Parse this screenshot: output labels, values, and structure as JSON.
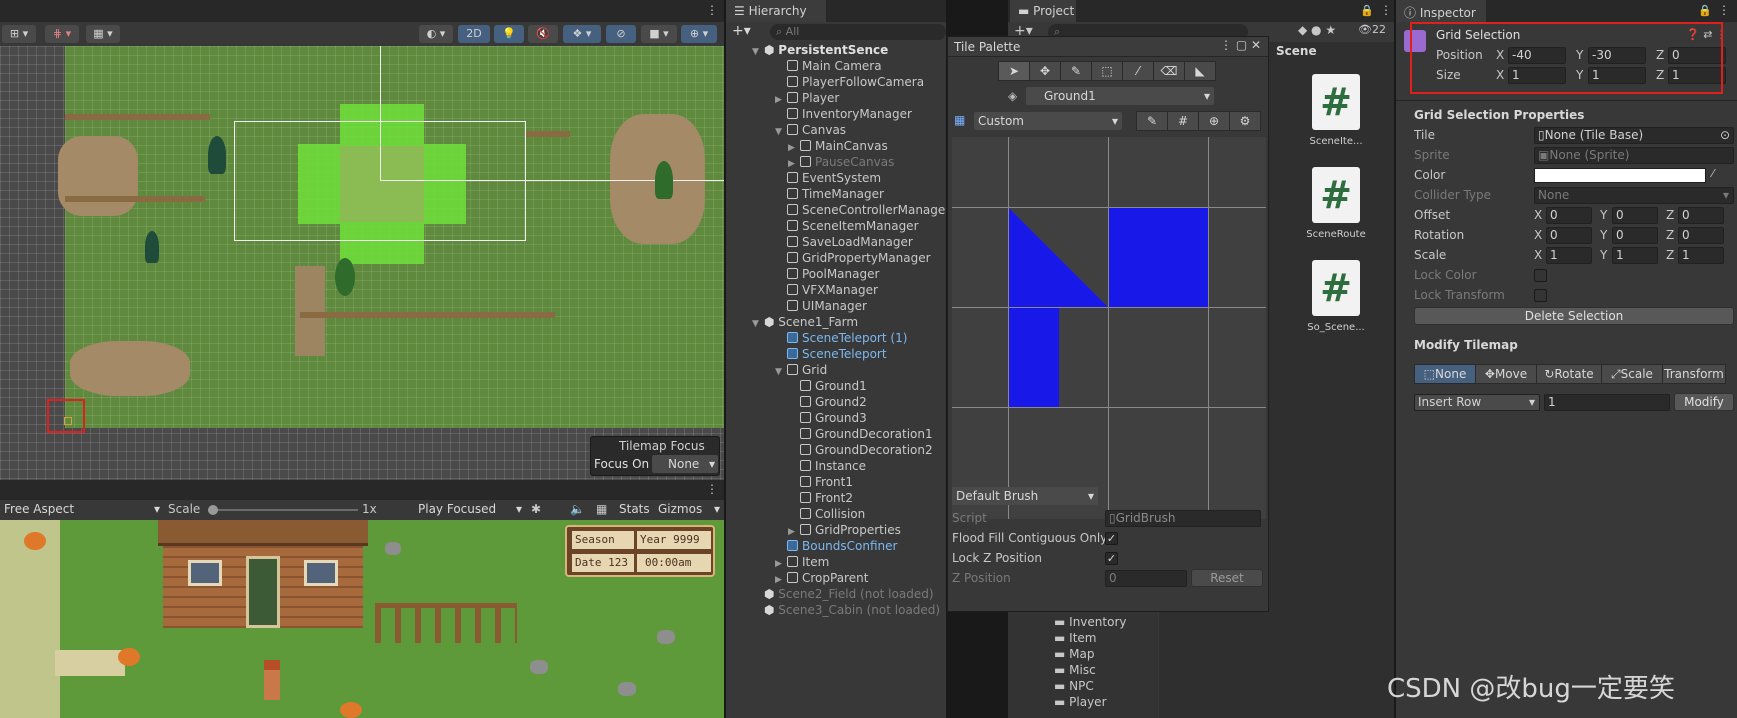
{
  "scene_view": {
    "focus_title": "Tilemap Focus",
    "focus_label": "Focus On",
    "focus_value": "None",
    "btn_2d": "2D"
  },
  "game_view": {
    "aspect": "Free Aspect",
    "scale_label": "Scale",
    "scale_value": "1x",
    "play_mode": "Play Focused",
    "stats": "Stats",
    "gizmos": "Gizmos",
    "hud": {
      "season": "Season",
      "year": "Year 9999",
      "date": "Date 123",
      "time": "00:00am"
    }
  },
  "hierarchy": {
    "tab": "Hierarchy",
    "search_placeholder": "All",
    "items": [
      {
        "label": "PersistentSence",
        "indent": 0,
        "type": "scene",
        "expanded": true,
        "bold": true
      },
      {
        "label": "Main Camera",
        "indent": 1,
        "type": "obj"
      },
      {
        "label": "PlayerFollowCamera",
        "indent": 1,
        "type": "obj"
      },
      {
        "label": "Player",
        "indent": 1,
        "type": "obj",
        "collapsed": true
      },
      {
        "label": "InventoryManager",
        "indent": 1,
        "type": "obj"
      },
      {
        "label": "Canvas",
        "indent": 1,
        "type": "obj",
        "expanded": true
      },
      {
        "label": "MainCanvas",
        "indent": 2,
        "type": "obj",
        "collapsed": true
      },
      {
        "label": "PauseCanvas",
        "indent": 2,
        "type": "obj",
        "collapsed": true,
        "dim": true
      },
      {
        "label": "EventSystem",
        "indent": 1,
        "type": "obj"
      },
      {
        "label": "TimeManager",
        "indent": 1,
        "type": "obj"
      },
      {
        "label": "SceneControllerManager",
        "indent": 1,
        "type": "obj"
      },
      {
        "label": "SceneItemManager",
        "indent": 1,
        "type": "obj"
      },
      {
        "label": "SaveLoadManager",
        "indent": 1,
        "type": "obj"
      },
      {
        "label": "GridPropertyManager",
        "indent": 1,
        "type": "obj"
      },
      {
        "label": "PoolManager",
        "indent": 1,
        "type": "obj"
      },
      {
        "label": "VFXManager",
        "indent": 1,
        "type": "obj"
      },
      {
        "label": "UIManager",
        "indent": 1,
        "type": "obj"
      },
      {
        "label": "Scene1_Farm",
        "indent": 0,
        "type": "scene",
        "expanded": true
      },
      {
        "label": "SceneTeleport (1)",
        "indent": 1,
        "type": "prefab"
      },
      {
        "label": "SceneTeleport",
        "indent": 1,
        "type": "prefab"
      },
      {
        "label": "Grid",
        "indent": 1,
        "type": "obj",
        "expanded": true
      },
      {
        "label": "Ground1",
        "indent": 2,
        "type": "obj"
      },
      {
        "label": "Ground2",
        "indent": 2,
        "type": "obj"
      },
      {
        "label": "Ground3",
        "indent": 2,
        "type": "obj"
      },
      {
        "label": "GroundDecoration1",
        "indent": 2,
        "type": "obj"
      },
      {
        "label": "GroundDecoration2",
        "indent": 2,
        "type": "obj"
      },
      {
        "label": "Instance",
        "indent": 2,
        "type": "obj"
      },
      {
        "label": "Front1",
        "indent": 2,
        "type": "obj"
      },
      {
        "label": "Front2",
        "indent": 2,
        "type": "obj"
      },
      {
        "label": "Collision",
        "indent": 2,
        "type": "obj"
      },
      {
        "label": "GridProperties",
        "indent": 2,
        "type": "obj",
        "collapsed": true
      },
      {
        "label": "BoundsConfiner",
        "indent": 1,
        "type": "prefab"
      },
      {
        "label": "Item",
        "indent": 1,
        "type": "obj",
        "collapsed": true
      },
      {
        "label": "CropParent",
        "indent": 1,
        "type": "obj",
        "collapsed": true
      },
      {
        "label": "Scene2_Field (not loaded)",
        "indent": 0,
        "type": "scene",
        "dim": true
      },
      {
        "label": "Scene3_Cabin (not loaded)",
        "indent": 0,
        "type": "scene",
        "dim": true
      }
    ]
  },
  "project": {
    "tab": "Project",
    "badge": "22",
    "scene_header": "Scene",
    "assets": [
      "SceneIte...",
      "SceneRoute",
      "So_Scene..."
    ],
    "folders": [
      "Inventory",
      "Item",
      "Map",
      "Misc",
      "NPC",
      "Player"
    ]
  },
  "tile_palette": {
    "title": "Tile Palette",
    "active_tilemap": "Ground1",
    "palette": "Custom",
    "brush": "Default Brush",
    "script_label": "Script",
    "script_value": "GridBrush",
    "flood_label": "Flood Fill Contiguous Only",
    "lockz_label": "Lock Z Position",
    "zpos_label": "Z Position",
    "zpos_value": "0",
    "reset": "Reset"
  },
  "inspector": {
    "tab": "Inspector",
    "title": "Grid Selection",
    "position_label": "Position",
    "size_label": "Size",
    "position": {
      "x": "-40",
      "y": "-30",
      "z": "0"
    },
    "size": {
      "x": "1",
      "y": "1",
      "z": "1"
    },
    "props_header": "Grid Selection Properties",
    "tile_label": "Tile",
    "tile_value": "None (Tile Base)",
    "sprite_label": "Sprite",
    "sprite_value": "None (Sprite)",
    "color_label": "Color",
    "collider_label": "Collider Type",
    "collider_value": "None",
    "offset_label": "Offset",
    "offset": {
      "x": "0",
      "y": "0",
      "z": "0"
    },
    "rotation_label": "Rotation",
    "rotation": {
      "x": "0",
      "y": "0",
      "z": "0"
    },
    "scale_label": "Scale",
    "scale": {
      "x": "1",
      "y": "1",
      "z": "1"
    },
    "lock_color": "Lock Color",
    "lock_transform": "Lock Transform",
    "delete_btn": "Delete Selection",
    "modify_header": "Modify Tilemap",
    "tools": [
      "None",
      "Move",
      "Rotate",
      "Scale",
      "Transform"
    ],
    "insert_value": "Insert Row",
    "insert_count": "1",
    "modify_btn": "Modify",
    "x": "X",
    "y": "Y",
    "z": "Z"
  },
  "watermark": "CSDN @改bug一定要笑"
}
